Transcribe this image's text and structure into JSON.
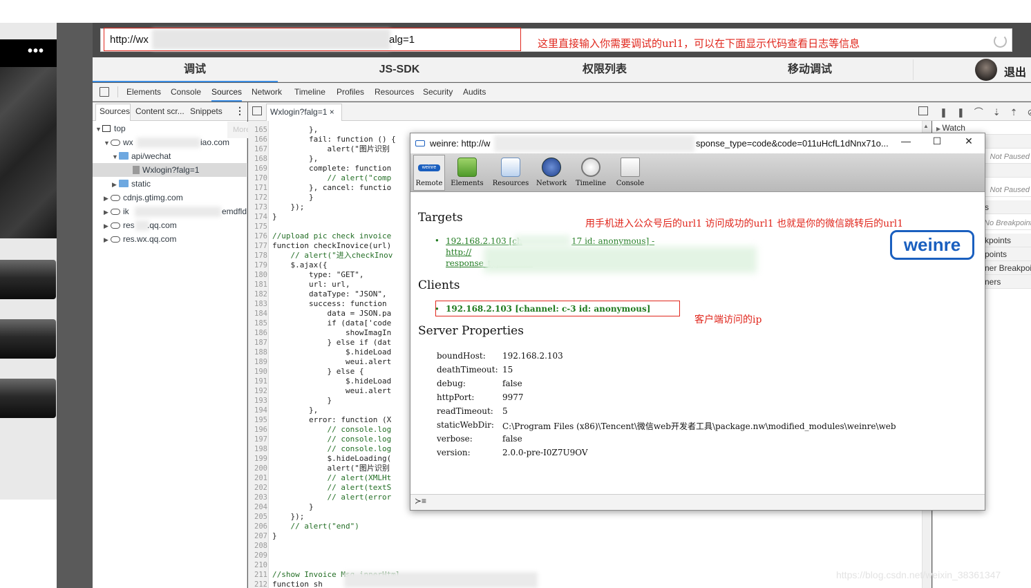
{
  "url_bar": {
    "url_prefix": "http://wx",
    "url_suffix": "alg=1",
    "annotation": "这里直接输入你需要调试的url1，可以在下面显示代码查看日志等信息"
  },
  "phone": {
    "menu_label": "•••"
  },
  "main_tabs": [
    "调试",
    "JS-SDK",
    "权限列表",
    "移动调试"
  ],
  "user": {
    "logout_label": "退出"
  },
  "devtools_tabs": [
    "Elements",
    "Console",
    "Sources",
    "Network",
    "Timeline",
    "Profiles",
    "Resources",
    "Security",
    "Audits"
  ],
  "sources_subtabs": [
    "Sources",
    "Content scr...",
    "Snippets"
  ],
  "more_options": "More options",
  "tree": {
    "top": "top",
    "host1_prefix": "wx",
    "host1_suffix": "iao.com",
    "folder_wechat": "api/wechat",
    "file_selected": "Wxlogin?falg=1",
    "folder_static": "static",
    "host2": "cdnjs.gtimg.com",
    "host3_prefix": "ik",
    "host3_suffix": "emdfld",
    "host4_prefix": "res",
    "host4_suffix": ".qq.com",
    "host5": "res.wx.qq.com"
  },
  "editor_tab": {
    "label": "Wxlogin?falg=1",
    "close": "×"
  },
  "code_lines": [
    {
      "n": "165",
      "t": "        },"
    },
    {
      "n": "166",
      "t": "        fail: function () {"
    },
    {
      "n": "167",
      "t": "            alert(\"图片识别"
    },
    {
      "n": "168",
      "t": "        },"
    },
    {
      "n": "169",
      "t": "        complete: function"
    },
    {
      "n": "170",
      "t": "            // alert(\"comp"
    },
    {
      "n": "171",
      "t": "        }, cancel: functio"
    },
    {
      "n": "172",
      "t": "        }"
    },
    {
      "n": "173",
      "t": "    });"
    },
    {
      "n": "174",
      "t": "}"
    },
    {
      "n": "175",
      "t": ""
    },
    {
      "n": "176",
      "t": "//upload pic check invoice"
    },
    {
      "n": "177",
      "t": "function checkInovice(url)"
    },
    {
      "n": "178",
      "t": "    // alert(\"进入checkInov"
    },
    {
      "n": "179",
      "t": "    $.ajax({"
    },
    {
      "n": "180",
      "t": "        type: \"GET\","
    },
    {
      "n": "181",
      "t": "        url: url,"
    },
    {
      "n": "182",
      "t": "        dataType: \"JSON\","
    },
    {
      "n": "183",
      "t": "        success: function"
    },
    {
      "n": "184",
      "t": "            data = JSON.pa"
    },
    {
      "n": "185",
      "t": "            if (data['code"
    },
    {
      "n": "186",
      "t": "                showImagIn"
    },
    {
      "n": "187",
      "t": "            } else if (dat"
    },
    {
      "n": "188",
      "t": "                $.hideLoad"
    },
    {
      "n": "189",
      "t": "                weui.alert"
    },
    {
      "n": "190",
      "t": "            } else {"
    },
    {
      "n": "191",
      "t": "                $.hideLoad"
    },
    {
      "n": "192",
      "t": "                weui.alert"
    },
    {
      "n": "193",
      "t": "            }"
    },
    {
      "n": "194",
      "t": "        },"
    },
    {
      "n": "195",
      "t": "        error: function (X"
    },
    {
      "n": "196",
      "t": "            // console.log"
    },
    {
      "n": "197",
      "t": "            // console.log"
    },
    {
      "n": "198",
      "t": "            // console.log"
    },
    {
      "n": "199",
      "t": "            $.hideLoading("
    },
    {
      "n": "200",
      "t": "            alert(\"图片识别"
    },
    {
      "n": "201",
      "t": "            // alert(XMLHt"
    },
    {
      "n": "202",
      "t": "            // alert(textS"
    },
    {
      "n": "203",
      "t": "            // alert(error"
    },
    {
      "n": "204",
      "t": "        }"
    },
    {
      "n": "205",
      "t": "    });"
    },
    {
      "n": "206",
      "t": "    // alert(\"end\")"
    },
    {
      "n": "207",
      "t": "}"
    },
    {
      "n": "208",
      "t": ""
    },
    {
      "n": "209",
      "t": ""
    },
    {
      "n": "210",
      "t": ""
    },
    {
      "n": "211",
      "t": "//show Invoice Msg innerHtml"
    },
    {
      "n": "212",
      "t": "function sh"
    }
  ],
  "right_pane": {
    "watch": "Watch",
    "not_paused_1": "Not Paused",
    "not_paused_2": "Not Paused",
    "s": "s",
    "no_breakpoints": "No Breakpoints",
    "kpoints": "kpoints",
    "points": "points",
    "ner_breakpoints": "ner Breakpoints",
    "ners": "ners"
  },
  "weinre_window": {
    "title_prefix": "weinre: http://w",
    "title_suffix": "sponse_type=code&code=011uHcfL1dNnx71o...",
    "minimize": "—",
    "maximize": "☐",
    "close": "✕",
    "tools": [
      "Remote",
      "Elements",
      "Resources",
      "Network",
      "Timeline",
      "Console"
    ],
    "remote_badge": "weinre",
    "targets_heading": "Targets",
    "target_link_1": "192.168.2.103 [ch",
    "target_link_1b": "17 id: anonymous] -",
    "target_link_2": "http://",
    "target_link_3": "response_type=code",
    "targets_annotation": "用手机进入公众号后的url1 访问成功的url1 也就是你的微信跳转后的url1",
    "logo": "weinre",
    "clients_heading": "Clients",
    "client_link": "192.168.2.103 [channel: c-3 id: anonymous]",
    "client_annotation": "客户端访问的ip",
    "server_heading": "Server Properties",
    "props": [
      {
        "k": "boundHost:",
        "v": "192.168.2.103"
      },
      {
        "k": "deathTimeout:",
        "v": "15"
      },
      {
        "k": "debug:",
        "v": "false"
      },
      {
        "k": "httpPort:",
        "v": "9977"
      },
      {
        "k": "readTimeout:",
        "v": "5"
      },
      {
        "k": "staticWebDir:",
        "v": "C:\\Program Files (x86)\\Tencent\\微信web开发者工具\\package.nw\\modified_modules\\weinre\\web"
      },
      {
        "k": "verbose:",
        "v": "false"
      },
      {
        "k": "version:",
        "v": "2.0.0-pre-I0Z7U9OV"
      }
    ],
    "console_prompt": "≻≡"
  },
  "watermark": "https://blog.csdn.net/weixin_38361347",
  "colors": {
    "annotation_red": "#e0261c",
    "link_green": "#1f7a1f",
    "accent_blue": "#3b8de3"
  }
}
